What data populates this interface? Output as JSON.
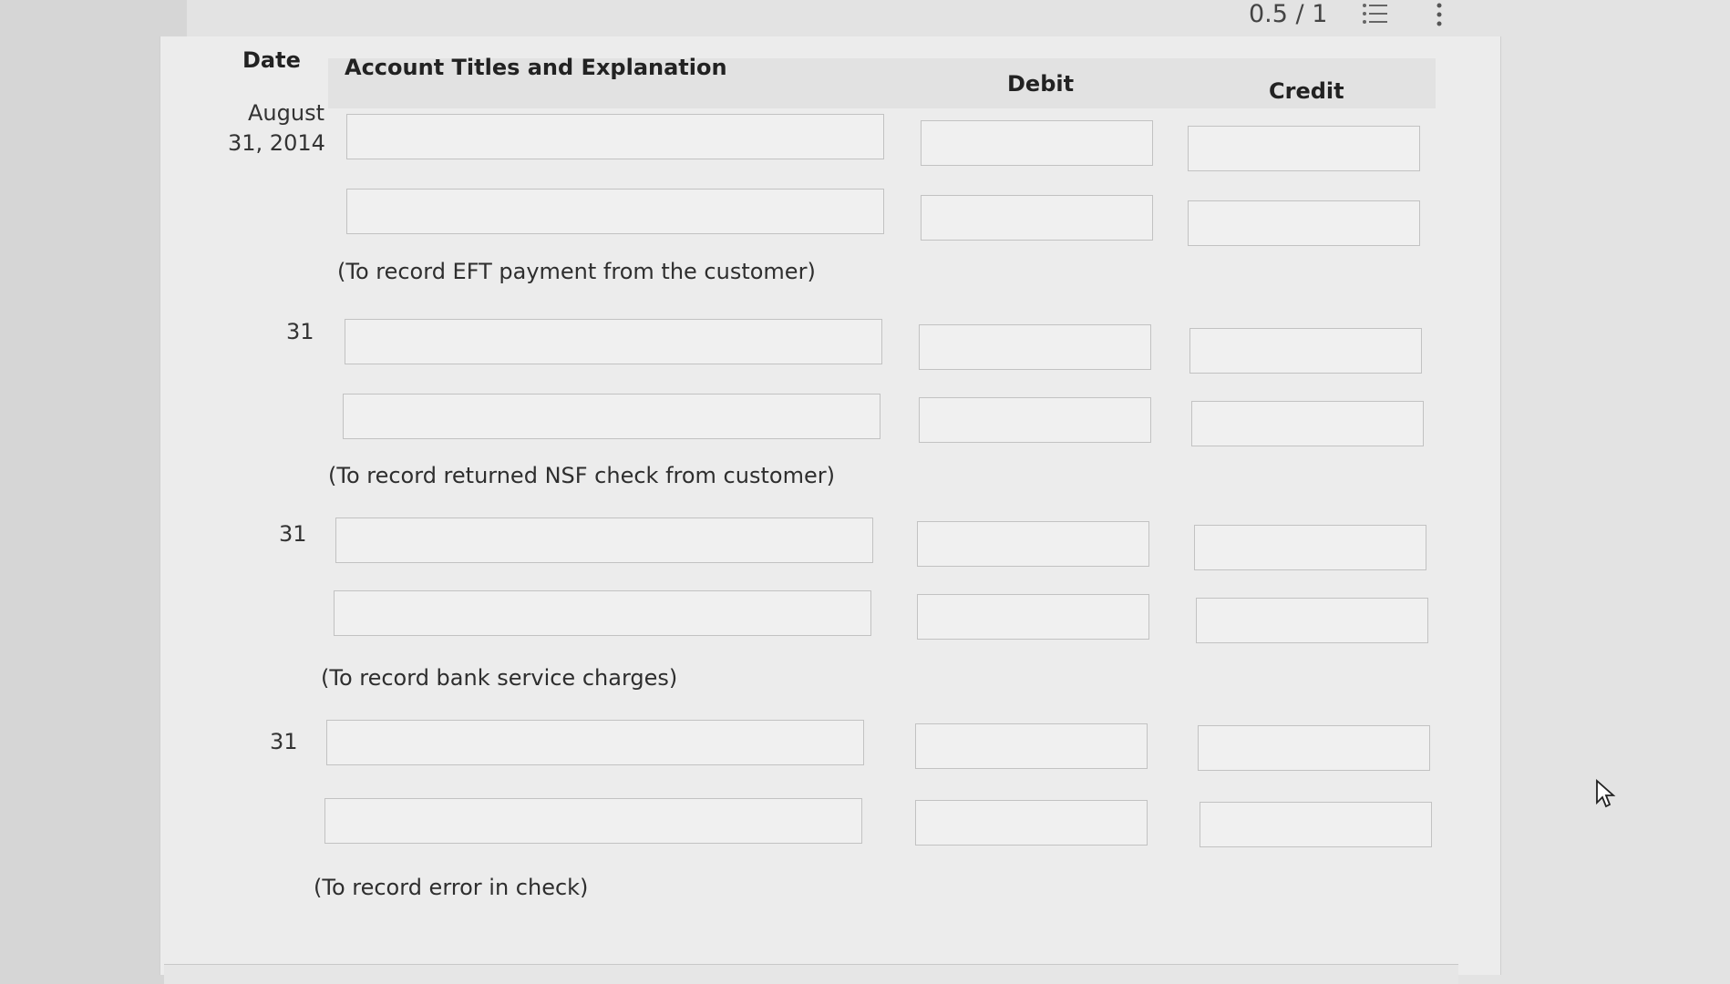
{
  "topbar": {
    "score": "0.5 / 1",
    "list_icon": "list-icon",
    "more_icon": "vertical-dots-icon"
  },
  "table": {
    "headers": {
      "date": "Date",
      "account": "Account Titles and Explanation",
      "debit": "Debit",
      "credit": "Credit"
    },
    "entries": [
      {
        "date_line1": "August",
        "date_line2": "31, 2014",
        "lines": [
          {
            "account": "",
            "debit": "",
            "credit": ""
          },
          {
            "account": "",
            "debit": "",
            "credit": ""
          }
        ],
        "explanation": "(To record EFT payment from the customer)"
      },
      {
        "date_line1": "31",
        "date_line2": "",
        "lines": [
          {
            "account": "",
            "debit": "",
            "credit": ""
          },
          {
            "account": "",
            "debit": "",
            "credit": ""
          }
        ],
        "explanation": "(To record returned NSF check from customer)"
      },
      {
        "date_line1": "31",
        "date_line2": "",
        "lines": [
          {
            "account": "",
            "debit": "",
            "credit": ""
          },
          {
            "account": "",
            "debit": "",
            "credit": ""
          }
        ],
        "explanation": "(To record bank service charges)"
      },
      {
        "date_line1": "31",
        "date_line2": "",
        "lines": [
          {
            "account": "",
            "debit": "",
            "credit": ""
          },
          {
            "account": "",
            "debit": "",
            "credit": ""
          }
        ],
        "explanation": "(To record error in check)"
      }
    ]
  }
}
